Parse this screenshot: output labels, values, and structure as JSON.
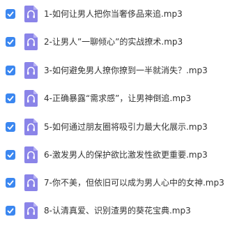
{
  "colors": {
    "checkbox": "#3b87f0",
    "file_icon": "#8a84e8",
    "file_icon_fold": "#b7b2f3",
    "text": "#333333"
  },
  "icons": {
    "checkbox": "check-icon",
    "file": "audio-file-icon"
  },
  "files": [
    {
      "name": "1-如何让男人把你当奢侈品来追.mp3",
      "checked": true
    },
    {
      "name": "2-让男人”一聊倾心”的实战撩术.mp3",
      "checked": true
    },
    {
      "name": "3-如何避免男人撩你撩到一半就消失？.mp3",
      "checked": true
    },
    {
      "name": "4-正确暴露“需求感”，让男神倒追.mp3",
      "checked": true
    },
    {
      "name": "5-如何通过朋友圈将吸引力最大化展示.mp3",
      "checked": true
    },
    {
      "name": "6-激发男人的保护欲比激发性欲更重要.mp3",
      "checked": true
    },
    {
      "name": "7-你不美，但依旧可以成为男人心中的女神.mp3",
      "checked": true
    },
    {
      "name": "8-认清真爱、识别渣男的葵花宝典.mp3",
      "checked": true
    }
  ]
}
